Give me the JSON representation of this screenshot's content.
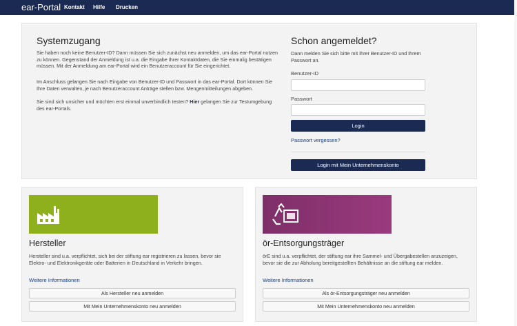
{
  "nav": {
    "brand": "ear-Portal",
    "links": [
      "Kontakt",
      "Hilfe",
      "Drucken"
    ]
  },
  "system": {
    "title": "Systemzugang",
    "para1": "Sie haben noch keine Benutzer-ID? Dann müssen Sie sich zunächst neu anmelden, um das ear-Portal nutzen zu können. Gegenstand der Anmeldung ist u.a. die Eingabe Ihrer Kontaktdaten, die Sie einmalig bestätigen müssen. Mit der Anmeldung am ear-Portal wird ein Benutzeraccount für Sie eingerichtet.",
    "para2": "Im Anschluss gelangen Sie nach Eingabe von Benutzer-ID und Passwort in das ear-Portal. Dort können Sie Ihre Daten verwalten, je nach Benutzeraccount Anträge stellen bzw. Mengenmitteilungen abgeben.",
    "para3_before": "Sie sind sich unsicher und möchten erst einmal unverbindlich testen? ",
    "para3_link": "Hier",
    "para3_after": " gelangen Sie zur Testumgebung des ear-Portals."
  },
  "login": {
    "title": "Schon angemeldet?",
    "intro": "Dann melden Sie sich bitte mit Ihrer Benutzer-ID und Ihrem Passwort an.",
    "userid_label": "Benutzer-ID",
    "userid_value": "",
    "password_label": "Passwort",
    "password_value": "",
    "login_button": "Login",
    "forgot_link": "Passwort vergessen?",
    "company_login_button": "Login mit Mein Unternehmenskonto"
  },
  "manufacturer": {
    "title": "Hersteller",
    "text": "Hersteller sind u.a. verpflichtet, sich bei der stiftung ear registrieren zu lassen, bevor sie Elektro- und Elektronikgeräte oder Batterien in Deutschland in Verkehr bringen.",
    "more_link": "Weitere Informationen",
    "register_button": "Als Hersteller neu anmelden",
    "company_button": "Mit Mein Unternehmenskonto neu anmelden",
    "banner_color": "#8fb01d",
    "icon": "factory-icon"
  },
  "disposal": {
    "title": "ör-Entsorgungsträger",
    "text": "örE sind u.a. verpflichtet, der stiftung ear ihre Sammel- und Übergabestellen anzuzeigen, bevor sie die zur Abholung bereitgestellten Behältnisse an die stiftung ear melden.",
    "more_link": "Weitere Informationen",
    "register_button": "Als ör-Entsorgungsträger neu anmelden",
    "company_button": "Mit Mein Unternehmenskonto neu anmelden",
    "banner_color": "#8a3575",
    "icon": "recycling-container-icon"
  }
}
